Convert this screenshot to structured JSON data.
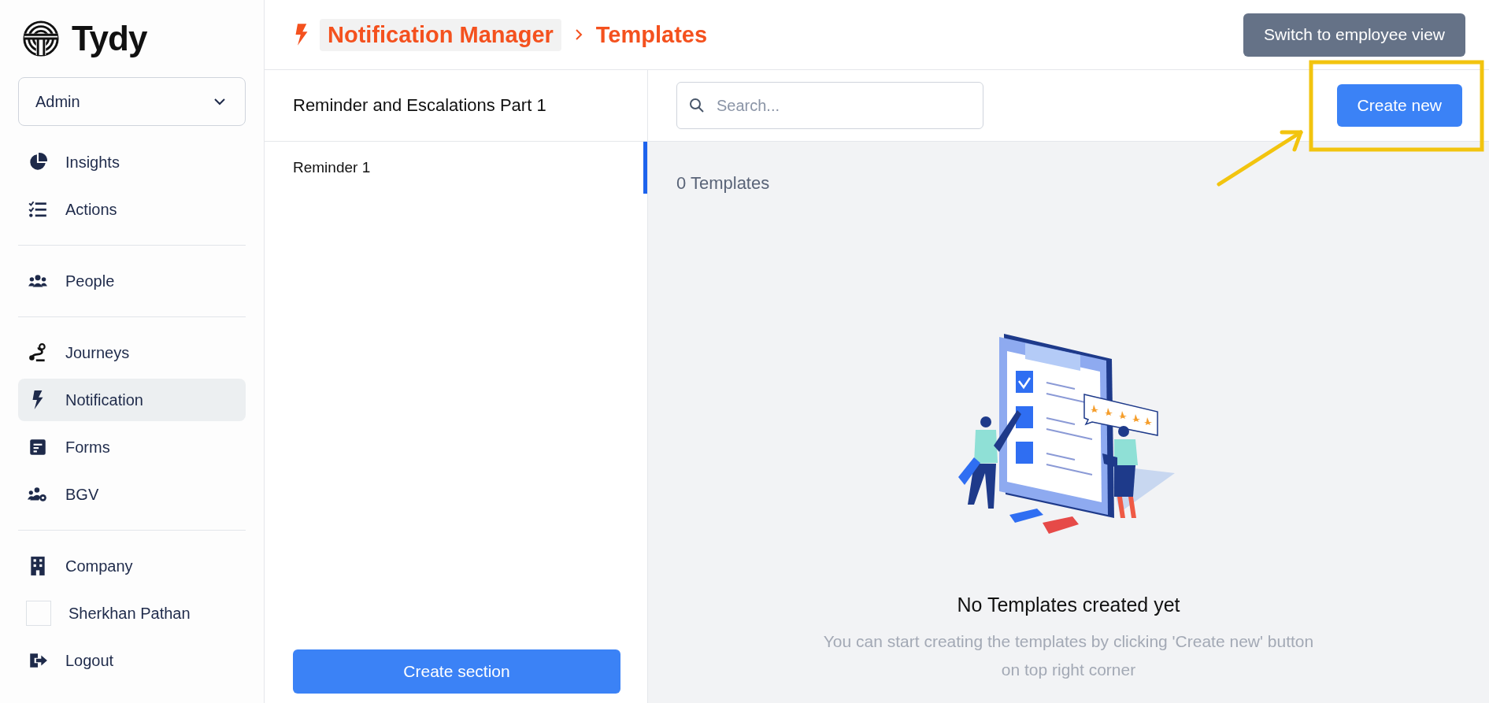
{
  "brand": {
    "name": "Tydy"
  },
  "sidebar": {
    "role_select": {
      "value": "Admin"
    },
    "groups": [
      {
        "items": [
          {
            "label": "Insights",
            "kind": "link",
            "selected": false
          },
          {
            "label": "Actions",
            "kind": "link",
            "selected": false
          }
        ]
      },
      {
        "items": [
          {
            "label": "People",
            "kind": "link",
            "selected": false
          }
        ]
      },
      {
        "items": [
          {
            "label": "Journeys",
            "kind": "link",
            "selected": false
          },
          {
            "label": "Notification",
            "kind": "link",
            "selected": true
          },
          {
            "label": "Forms",
            "kind": "link",
            "selected": false
          },
          {
            "label": "BGV",
            "kind": "link",
            "selected": false
          }
        ]
      },
      {
        "items": [
          {
            "label": "Company",
            "kind": "link",
            "selected": false
          },
          {
            "label": "Sherkhan Pathan",
            "kind": "profile",
            "selected": false
          },
          {
            "label": "Logout",
            "kind": "link",
            "selected": false
          }
        ]
      }
    ]
  },
  "breadcrumb": [
    {
      "label": "Notification Manager",
      "kind": "link"
    },
    {
      "label": "Templates",
      "kind": "current"
    }
  ],
  "header_button": "Switch to employee view",
  "section_panel": {
    "title": "Reminder and Escalations Part 1",
    "items": [
      {
        "label": "Reminder 1",
        "selected": true
      }
    ],
    "button": "Create section"
  },
  "templates": {
    "search": {
      "placeholder": "Search..."
    },
    "create_button": "Create new",
    "count": "0 Templates",
    "empty_title": "No Templates created yet",
    "empty_text": "You can start creating the templates by clicking 'Create new' button on top right corner"
  }
}
